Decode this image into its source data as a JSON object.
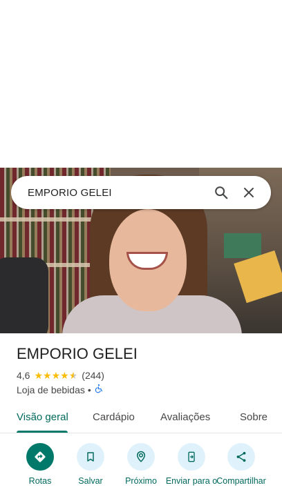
{
  "search": {
    "query": "EMPORIO GELEI"
  },
  "place": {
    "name": "EMPORIO GELEI",
    "rating": "4,6",
    "rating_stars": 4.6,
    "review_count": "(244)",
    "category": "Loja de bebidas",
    "separator": "•",
    "accessibility_icon": "wheelchair-icon"
  },
  "tabs": [
    {
      "label": "Visão geral",
      "active": true
    },
    {
      "label": "Cardápio",
      "active": false
    },
    {
      "label": "Avaliações",
      "active": false
    },
    {
      "label": "Sobre",
      "active": false
    }
  ],
  "actions": [
    {
      "label": "Rotas",
      "icon": "directions-icon"
    },
    {
      "label": "Salvar",
      "icon": "bookmark-icon"
    },
    {
      "label": "Próximo",
      "icon": "nearby-icon"
    },
    {
      "label": "Enviar para o",
      "icon": "send-to-phone-icon"
    },
    {
      "label": "Compartilhar",
      "icon": "share-icon"
    }
  ],
  "colors": {
    "accent": "#00796b",
    "accent_text": "#00695c",
    "action_bg": "#dff2fb",
    "star": "#fbbc04"
  }
}
